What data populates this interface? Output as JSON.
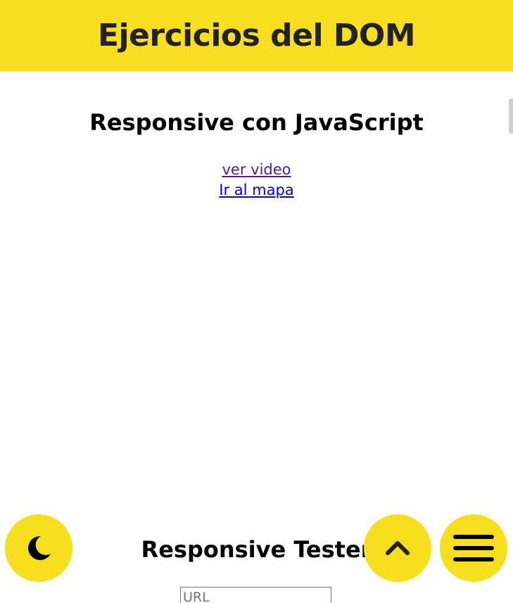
{
  "header": {
    "title": "Ejercicios del DOM"
  },
  "responsive_js": {
    "title": "Responsive con JavaScript",
    "links": [
      {
        "label": "ver video"
      },
      {
        "label": "Ir al mapa"
      }
    ]
  },
  "responsive_tester": {
    "title": "Responsive Tester",
    "url_placeholder": "URL"
  },
  "buttons": {
    "dark_mode_icon": "moon-icon",
    "scroll_top_icon": "chevron-up-icon",
    "menu_icon": "hamburger-icon"
  },
  "colors": {
    "accent": "#f7df1e",
    "header_text": "#222222",
    "visited_link": "#551a8b",
    "link": "#0000ee"
  }
}
